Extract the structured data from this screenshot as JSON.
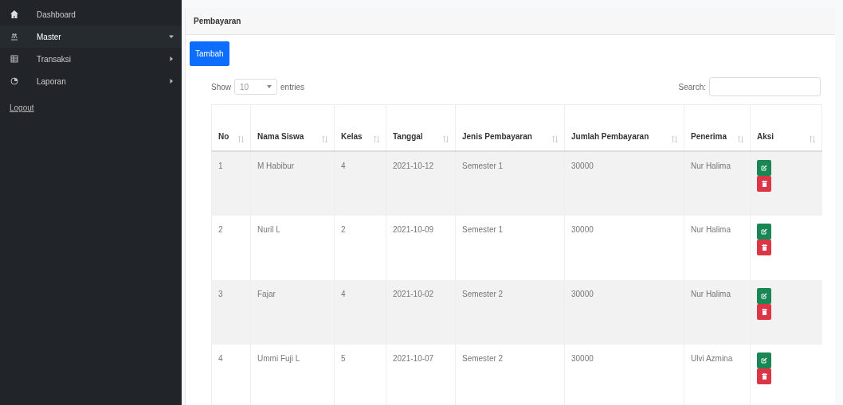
{
  "sidebar": {
    "items": [
      {
        "label": "Dashboard",
        "kind": "link",
        "expanded": false
      },
      {
        "label": "Master",
        "kind": "menu",
        "expanded": true
      },
      {
        "label": "Transaksi",
        "kind": "menu",
        "expanded": false
      },
      {
        "label": "Laporan",
        "kind": "menu",
        "expanded": false
      }
    ],
    "logout": "Logout"
  },
  "page": {
    "title": "Pembayaran",
    "add_button": "Tambah",
    "length": {
      "show": "Show",
      "value": "10",
      "entries": "entries"
    },
    "search": {
      "label": "Search:"
    },
    "table": {
      "columns": [
        "No",
        "Nama Siswa",
        "Kelas",
        "Tanggal",
        "Jenis Pembayaran",
        "Jumlah Pembayaran",
        "Penerima",
        "Aksi"
      ],
      "rows": [
        [
          "1",
          "M Habibur",
          "4",
          "2021-10-12",
          "Semester 1",
          "30000",
          "Nur Halima"
        ],
        [
          "2",
          "Nuril L",
          "2",
          "2021-10-09",
          "Semester 1",
          "30000",
          "Nur Halima"
        ],
        [
          "3",
          "Fajar",
          "4",
          "2021-10-02",
          "Semester 2",
          "30000",
          "Nur Halima"
        ],
        [
          "4",
          "Ummi Fuji L",
          "5",
          "2021-10-07",
          "Semester 2",
          "30000",
          "Ulvi Azmina"
        ]
      ]
    }
  }
}
